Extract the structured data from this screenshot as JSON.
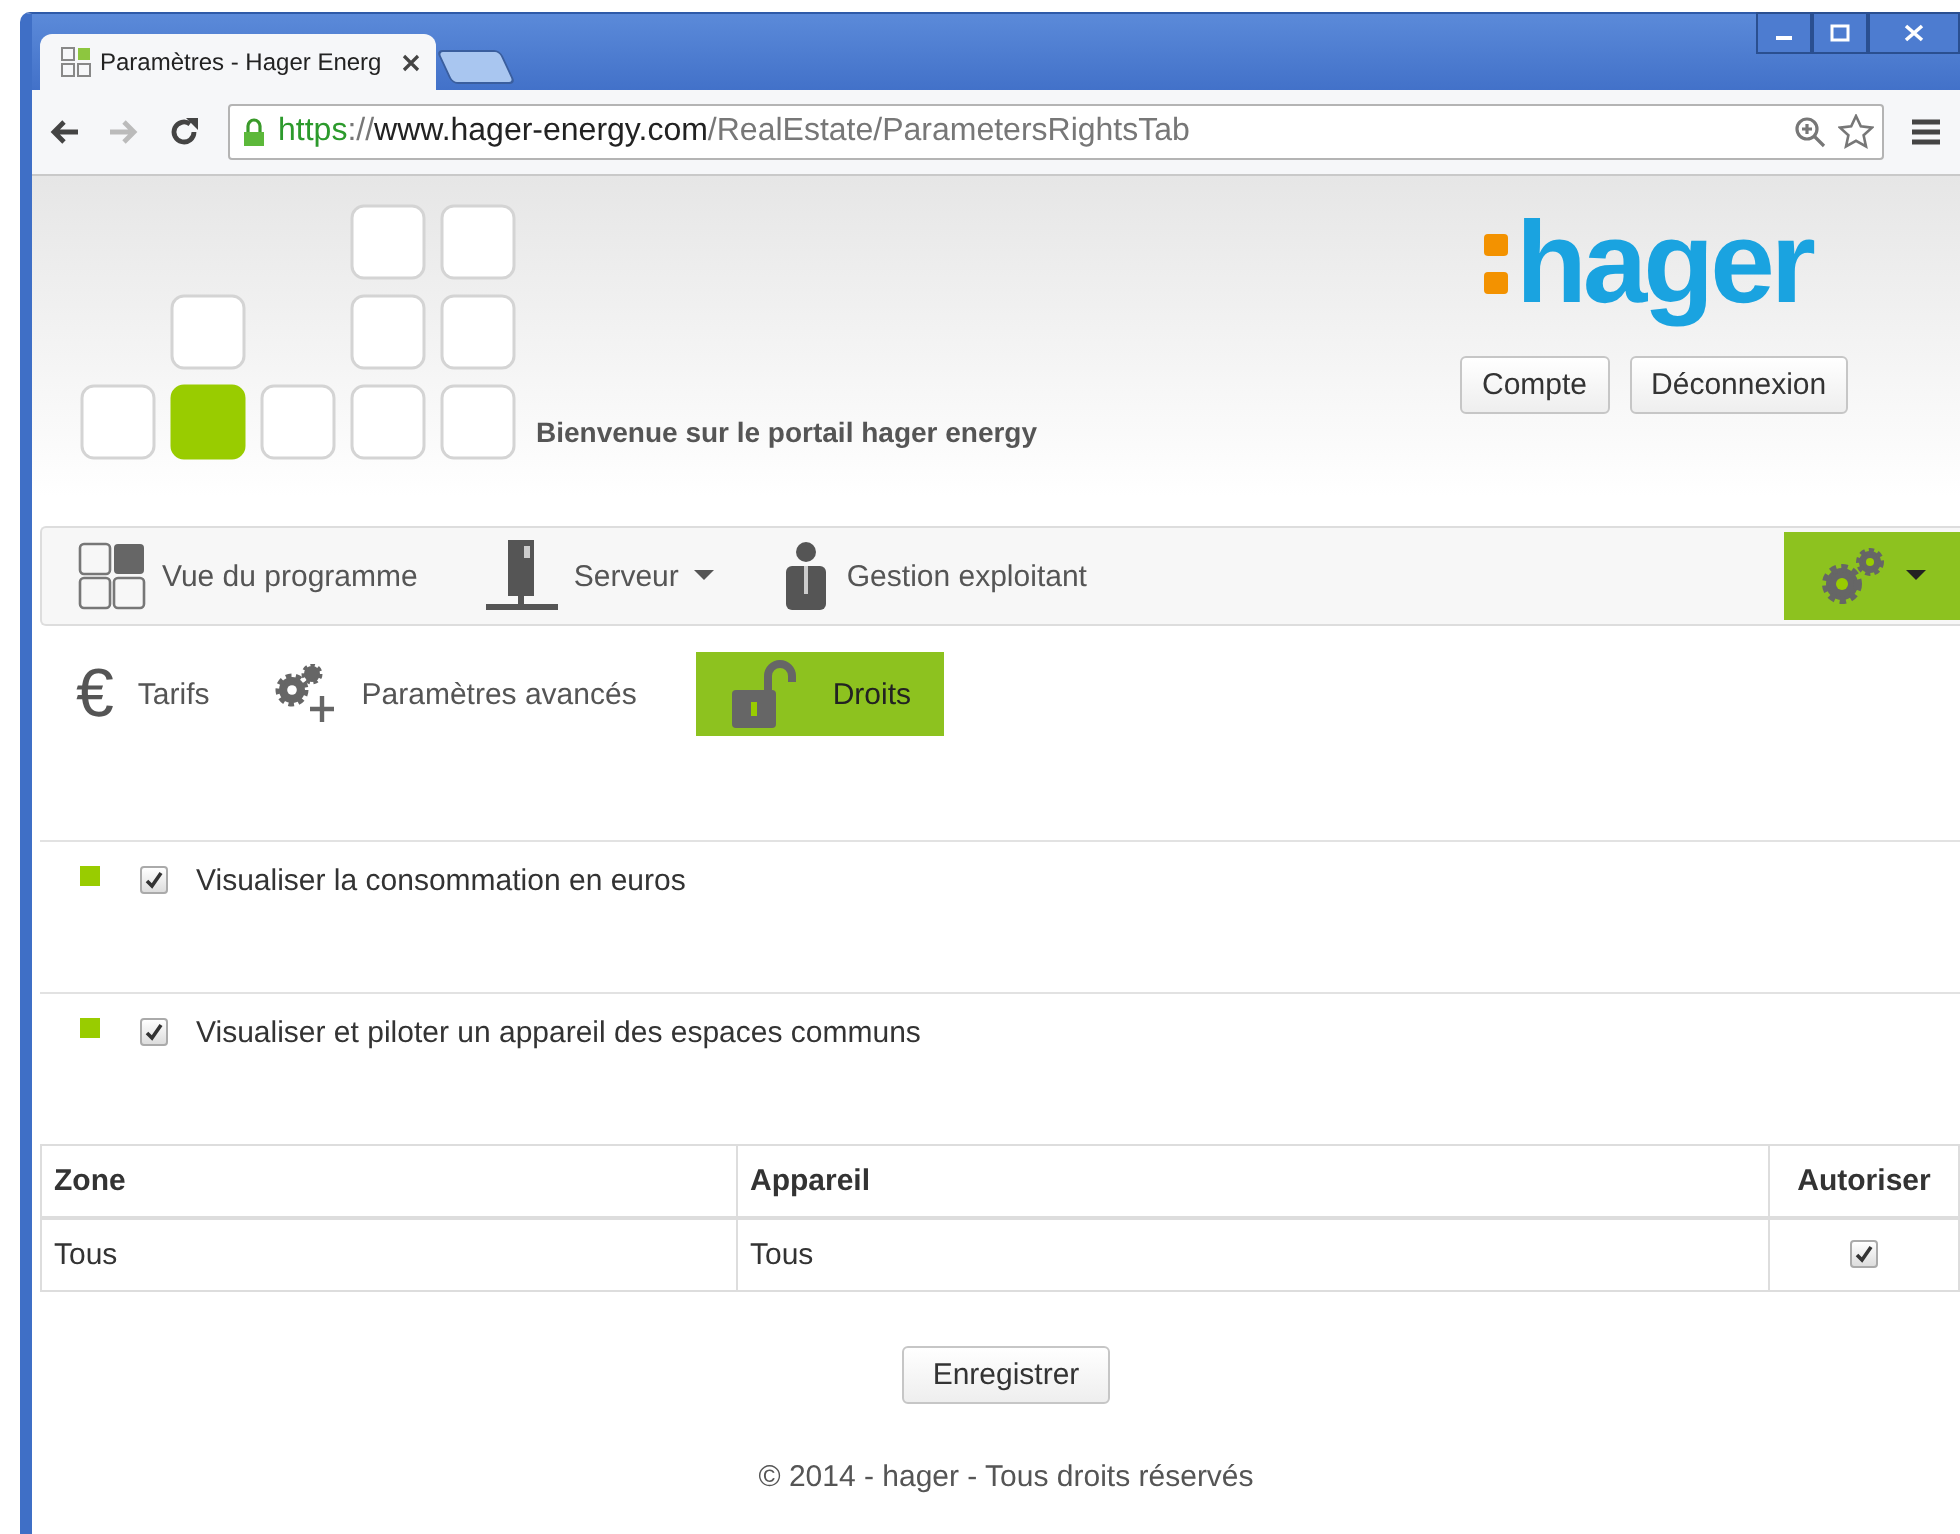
{
  "browser": {
    "tab_title": "Paramètres - Hager Energ",
    "url": {
      "scheme": "https",
      "separator": "://",
      "host": "www.hager-energy.com",
      "path": "/RealEstate/ParametersRightsTab"
    }
  },
  "header": {
    "logo": "hager",
    "welcome": "Bienvenue sur le portail hager energy",
    "buttons": [
      "Compte",
      "Déconnexion"
    ]
  },
  "nav": {
    "items": [
      {
        "label": "Vue du programme"
      },
      {
        "label": "Serveur"
      },
      {
        "label": "Gestion exploitant"
      }
    ],
    "settings": {
      "selected": true
    }
  },
  "subtabs": [
    {
      "label": "Tarifs",
      "glyph": "€",
      "selected": false
    },
    {
      "label": "Paramètres avancés",
      "selected": false
    },
    {
      "label": "Droits",
      "selected": true
    }
  ],
  "permissions": [
    {
      "label": "Visualiser la consommation en euros",
      "checked": true
    },
    {
      "label": "Visualiser et piloter un appareil des espaces communs",
      "checked": true
    }
  ],
  "table": {
    "columns": [
      "Zone",
      "Appareil",
      "Autoriser"
    ],
    "rows": [
      {
        "zone": "Tous",
        "device": "Tous",
        "authorized": true
      }
    ]
  },
  "save_button": "Enregistrer",
  "footer": "© 2014 - hager - Tous droits réservés"
}
